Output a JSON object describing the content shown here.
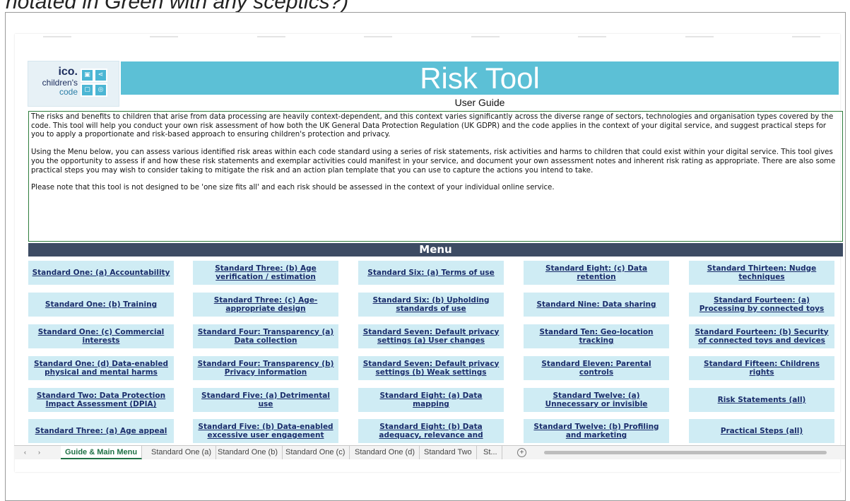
{
  "caption": "notated in Green with any sceptics?)",
  "logo": {
    "brand": "ico.",
    "line1": "children's",
    "line2": "code"
  },
  "header": {
    "title": "Risk Tool",
    "subtitle": "User Guide"
  },
  "intro": {
    "p1": "The risks and benefits to children that arise from data processing are heavily context-dependent, and this context varies significantly across the diverse range of sectors, technologies and organisation types covered by the code. This tool will help you conduct your own risk assessment of how both the UK General Data Protection Regulation (UK GDPR) and the code applies in the context of your digital service, and suggest practical steps for you to apply a proportionate and risk-based approach to ensuring children's protection and privacy.",
    "p2": "Using the Menu below, you can assess various identified risk areas within each code standard using a series of risk statements, risk activities and harms to children that could exist within your digital service. This tool gives you the opportunity to assess if and how these risk statements and exemplar activities could manifest in your service, and document your own assessment notes and inherent risk rating as appropriate. There are also some practical steps you may wish to consider taking to mitigate the risk and an action plan template that you can use to capture the actions you intend to take.",
    "p3": "Please note that this tool is not designed to be 'one size fits all' and each risk should be assessed in the context of your individual online service."
  },
  "menu": {
    "title": "Menu",
    "col1": [
      "Standard One: (a) Accountability",
      "Standard One: (b) Training",
      "Standard One: (c) Commercial interests",
      "Standard One: (d) Data-enabled physical and mental harms",
      "Standard Two: Data Protection Impact Assessment (DPIA)",
      "Standard Three: (a) Age appeal"
    ],
    "col2": [
      "Standard Three: (b) Age verification / estimation",
      "Standard Three: (c) Age-appropriate design",
      "Standard Four: Transparency (a) Data collection",
      "Standard Four: Transparency (b) Privacy information",
      "Standard Five: (a) Detrimental use",
      "Standard Five: (b) Data-enabled excessive user engagement"
    ],
    "col3": [
      "Standard Six: (a) Terms of use",
      "Standard Six: (b) Upholding standards of use",
      "Standard Seven: Default privacy settings (a) User changes",
      "Standard Seven: Default privacy settings (b) Weak settings",
      "Standard Eight: (a) Data mapping",
      "Standard Eight: (b) Data adequacy, relevance and"
    ],
    "col4": [
      "Standard Eight: (c) Data retention",
      "Standard Nine: Data sharing",
      "Standard Ten: Geo-location tracking",
      "Standard Eleven: Parental controls",
      "Standard Twelve: (a) Unnecessary or invisible",
      "Standard Twelve: (b) Profiling and marketing"
    ],
    "col5": [
      "Standard Thirteen: Nudge techniques",
      "Standard Fourteen: (a) Processing by connected toys",
      "Standard Fourteen: (b) Security of connected toys and devices",
      "Standard Fifteen: Childrens rights",
      "Risk Statements (all)",
      "Practical Steps (all)"
    ]
  },
  "tabs": {
    "nav_prev": "‹",
    "nav_next": "›",
    "items": [
      "Guide & Main Menu",
      "Standard One (a)",
      "Standard One (b)",
      "Standard One (c)",
      "Standard One (d)",
      "Standard Two",
      "St... "
    ],
    "add": "+"
  }
}
